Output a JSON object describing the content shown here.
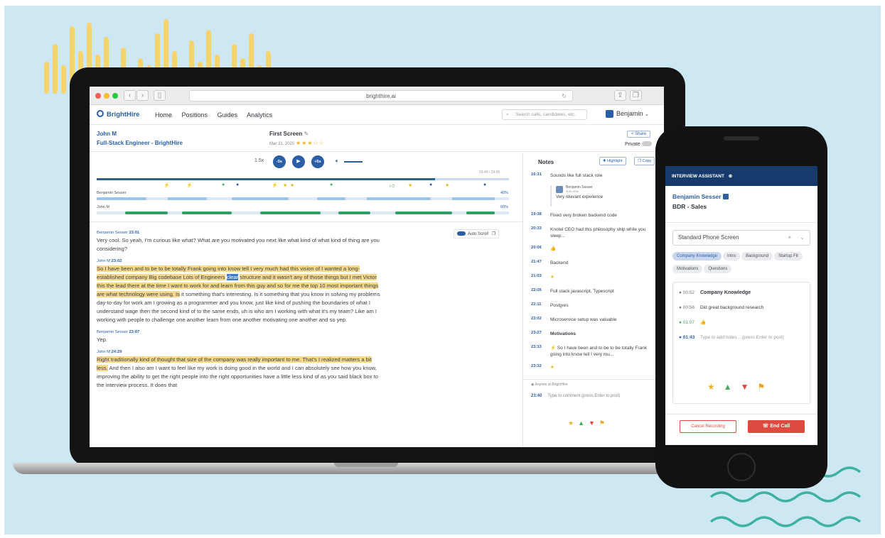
{
  "browser": {
    "url": "brighthire.ai"
  },
  "app": {
    "logo": "BrightHire",
    "nav": [
      "Home",
      "Positions",
      "Guides",
      "Analytics"
    ],
    "search_placeholder": "Search calls, candidates, etc.",
    "user": "Benjamin"
  },
  "header": {
    "candidate": "John M",
    "role": "Full-Stack Engineer - BrightHire",
    "interview": "First Screen",
    "date": "Mar 31, 2020",
    "rating": "★★★☆☆",
    "share": "< Share",
    "private": "Private"
  },
  "player": {
    "speed": "1.5x",
    "back": "-5s",
    "fwd": "+5s",
    "time": "23:45 / 29:00",
    "track1_name": "Benjamin Sesser",
    "track1_pct": "40%",
    "track2_name": "John M",
    "track2_pct": "60%"
  },
  "transcript": {
    "autoscroll": "Auto Scroll",
    "entries": [
      {
        "speaker": "Benjamin Sesser",
        "time": "23:01",
        "text": "Very cool. So yeah, I'm curious like what? What are you motivated you next like what kind of what kind of thing are you considering?"
      },
      {
        "speaker": "John M",
        "time": "23:02",
        "hl1": "So I have been and to be to be totally Frank going into know tell I very much had this vision of I wanted a long-established company Big codebase Lots of Engineers",
        "selected": "clear",
        "hl2": "structure and it wasn't any of those things but I met Victor this the lead there at the time I want to work for and learn from this guy and so for me the top 10 most important things are what technology were using. Is",
        "rest": " it something that's interesting. Is it something that you know in solving my problems day-to-day for work am I growing as a programmer and you know, just like kind of pushing the boundaries of what I understand wage then the second kind of to the same ends, uh is who am I working with what it's my team? Like am I working with people to challenge one another learn from one another motivating one another and so yep."
      },
      {
        "speaker": "Benjamin Sesser",
        "time": "23:07",
        "text": "Yep."
      },
      {
        "speaker": "John M",
        "time": "24:29",
        "hl1": "Right traditionally kind of thought that size of the company was really important to me. That's I realized matters a bit less.",
        "rest": " And then I also am I want to feel like my work is doing good in the world and I can absolutely see how you know, improving the ability to get the right people into the right opportunities have a little less kind of as you said black box to the interview process. It does that"
      }
    ]
  },
  "notes": {
    "title": "Notes",
    "highlight": "Highlight",
    "copy": "Copy",
    "items": [
      {
        "t": "16:31",
        "x": "Sounds like full stack role"
      },
      {
        "t": "19:38",
        "x": "Fixed very broken backend code"
      },
      {
        "t": "20:33",
        "x": "Knotel CEO had this philosophy ship while you sleep..."
      },
      {
        "t": "20:06",
        "x": "👍"
      },
      {
        "t": "21:47",
        "x": "Backend"
      },
      {
        "t": "21:03",
        "x": "★"
      },
      {
        "t": "22:05",
        "x": "Full stack javascript, Typescript"
      },
      {
        "t": "22:11",
        "x": "Postgres"
      },
      {
        "t": "23:02",
        "x": "Microservice setup was valuable"
      },
      {
        "t": "23:27",
        "x": "Motivations"
      },
      {
        "t": "23:33",
        "x": "⚡ So I have been and to be to be totally Frank going into know tell I very mu..."
      },
      {
        "t": "23:32",
        "x": "★"
      }
    ],
    "reply_name": "Benjamin Sesser",
    "reply_sub": "Just now",
    "reply_text": "Very relevant experience",
    "visibility": "Anyone at BrightHire",
    "comment_time": "23:40",
    "comment_placeholder": "Type to comment (press Enter to post)"
  },
  "assistant": {
    "title": "INTERVIEW ASSISTANT",
    "name": "Benjamin Sesser",
    "role": "BDR - Sales",
    "select": "Standard Phone Screen",
    "chips": [
      "Company Knowledge",
      "Intro",
      "Background",
      "Startup Fit",
      "Motivations",
      "Questions"
    ],
    "notes": [
      {
        "t": "00:52",
        "x": "Company Knowledge"
      },
      {
        "t": "00:56",
        "x": "Did great background research"
      },
      {
        "t": "01:07",
        "x": "👍"
      },
      {
        "t": "01:43",
        "x": "Type to add notes... (press Enter to post)"
      }
    ],
    "cancel": "Cancel Recording",
    "end": "End Call"
  },
  "colors": {
    "brand": "#2a5fa8",
    "highlight": "#f6d98a",
    "end_call": "#de4a3f",
    "navy": "#173a6c"
  }
}
